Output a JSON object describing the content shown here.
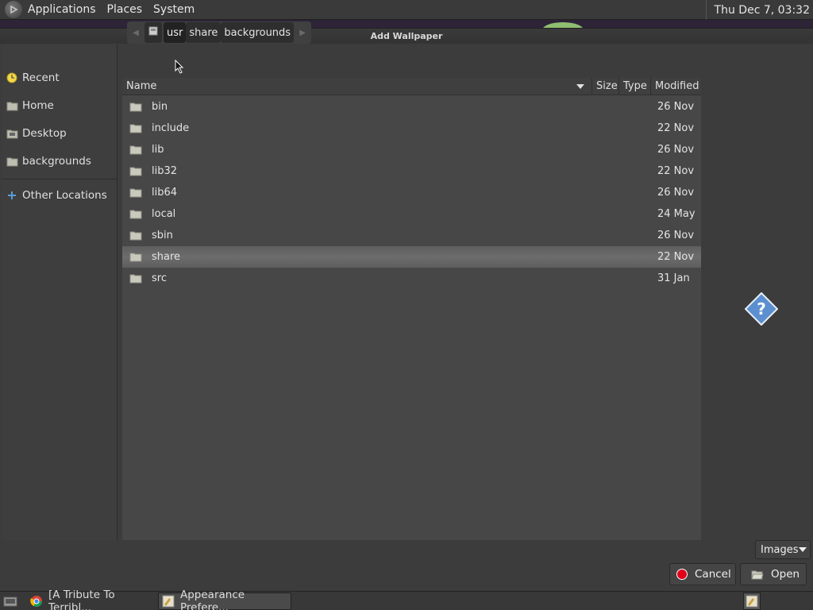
{
  "top_panel": {
    "menus": [
      "Applications",
      "Places",
      "System"
    ],
    "clock": "Thu Dec  7, 03:32"
  },
  "dialog": {
    "title": "Add Wallpaper",
    "sidebar": {
      "items": [
        {
          "label": "Recent",
          "icon": "recent-icon"
        },
        {
          "label": "Home",
          "icon": "home-icon"
        },
        {
          "label": "Desktop",
          "icon": "desktop-icon"
        },
        {
          "label": "backgrounds",
          "icon": "folder-icon"
        },
        {
          "label": "Other Locations",
          "icon": "plus-icon"
        }
      ]
    },
    "pathbar": {
      "crumbs": [
        "usr",
        "share",
        "backgrounds"
      ]
    },
    "columns": {
      "name": "Name",
      "size": "Size",
      "type": "Type",
      "modified": "Modified"
    },
    "files": [
      {
        "name": "bin",
        "modified": "26 Nov"
      },
      {
        "name": "include",
        "modified": "22 Nov"
      },
      {
        "name": "lib",
        "modified": "26 Nov"
      },
      {
        "name": "lib32",
        "modified": "22 Nov"
      },
      {
        "name": "lib64",
        "modified": "26 Nov"
      },
      {
        "name": "local",
        "modified": "24 May"
      },
      {
        "name": "sbin",
        "modified": "26 Nov"
      },
      {
        "name": "share",
        "modified": "22 Nov",
        "selected": true
      },
      {
        "name": "src",
        "modified": "31 Jan"
      }
    ],
    "filter": "Images",
    "buttons": {
      "cancel": "Cancel",
      "open": "Open"
    }
  },
  "taskbar": {
    "tasks": [
      {
        "label": "[A Tribute To Terribl...",
        "icon": "chrome-icon"
      },
      {
        "label": "Appearance Prefere...",
        "icon": "appearance-icon",
        "active": true
      }
    ]
  },
  "colors": {
    "selected_row": "#666666",
    "cancel_icon": "#e0001a",
    "help_icon": "#5b8fcf"
  }
}
